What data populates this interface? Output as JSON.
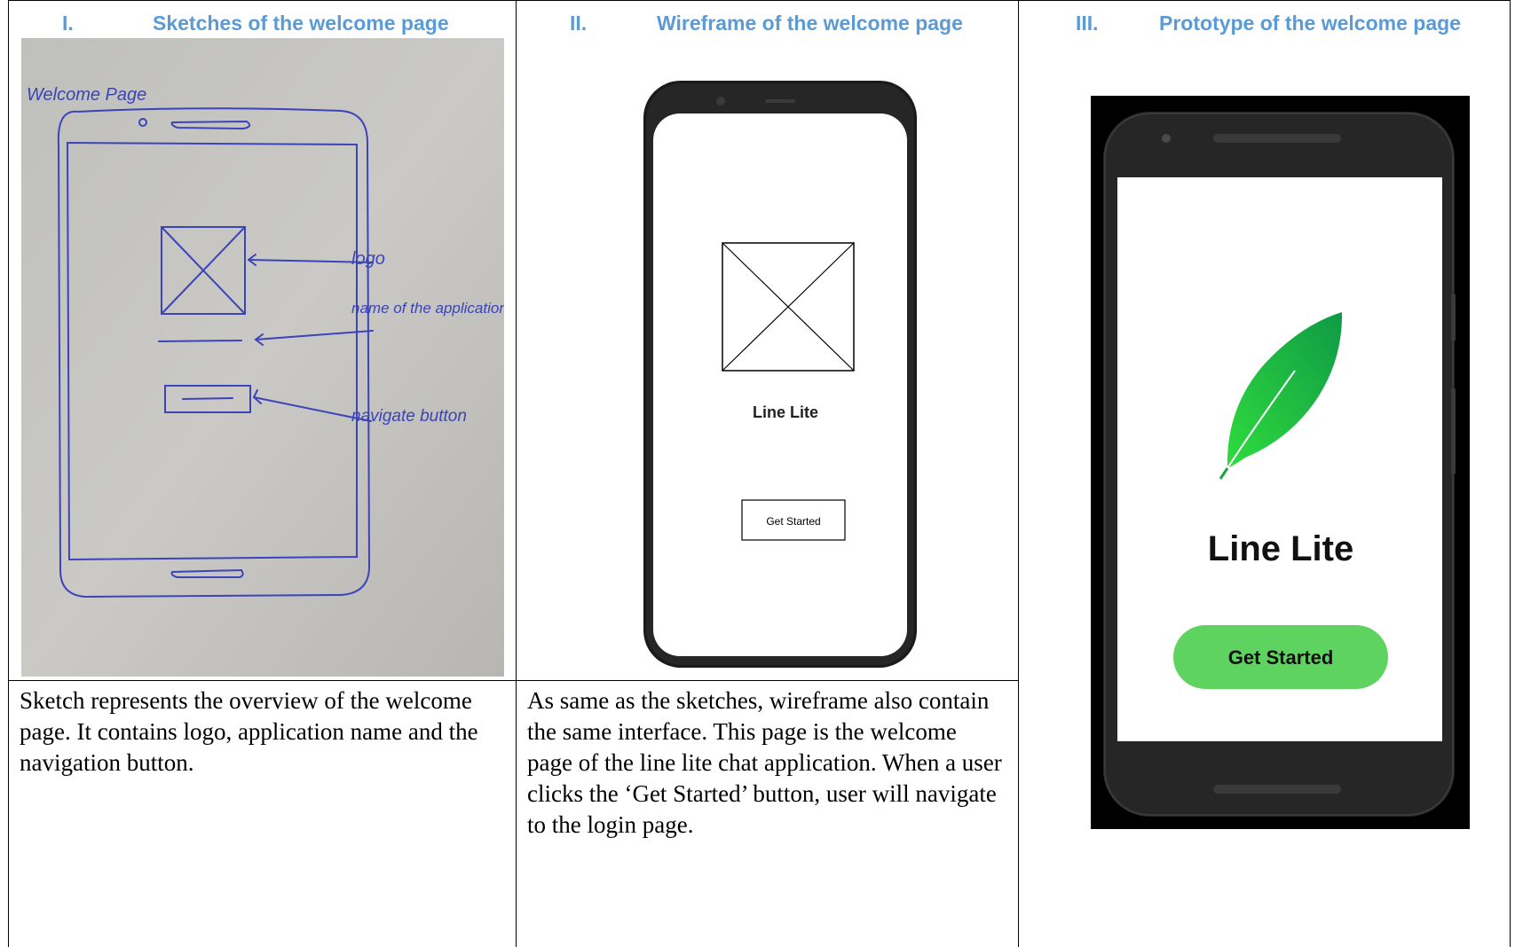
{
  "columns": [
    {
      "number": "I.",
      "title": "Sketches of the welcome  page",
      "sketch": {
        "heading": "Welcome  Page",
        "annotations": [
          "logo",
          "name of the application",
          "navigate button"
        ]
      },
      "description": "Sketch represents the overview of the welcome page. It contains logo, application name and the navigation button."
    },
    {
      "number": "II.",
      "title": "Wireframe  of the welcome page",
      "wireframe": {
        "app_name": "Line Lite",
        "button_label": "Get Started"
      },
      "description": "As same as the sketches, wireframe also contain the same interface. This page is the welcome page of the line lite chat application. When a user clicks the ‘Get Started’ button, user will navigate to the login page."
    },
    {
      "number": "III.",
      "title": "Prototype of the welcome page",
      "prototype": {
        "app_name": "Line Lite",
        "button_label": "Get Started",
        "logo_icon": "feather-icon",
        "button_color": "#5fd35f",
        "logo_color": "#22c84a"
      }
    }
  ]
}
